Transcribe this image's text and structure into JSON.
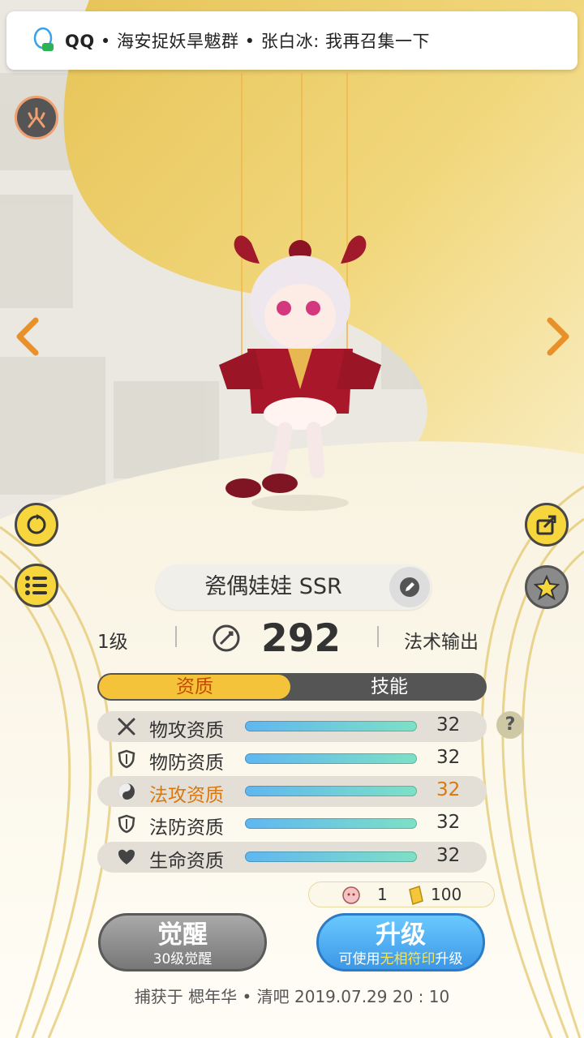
{
  "notification": {
    "app": "QQ",
    "text": "• 海安捉妖旱魃群 • 张白冰: 我再召集一下"
  },
  "pet": {
    "name": "瓷偶娃娃 SSR",
    "level": "1级",
    "power": "292",
    "role": "法术输出"
  },
  "tabs": {
    "active": "资质",
    "other": "技能"
  },
  "attributes": [
    {
      "icon": "crossed-swords-icon",
      "label": "物攻资质",
      "value": "32",
      "fill": 1.0
    },
    {
      "icon": "shield-icon",
      "label": "物防资质",
      "value": "32",
      "fill": 1.0
    },
    {
      "icon": "yin-yang-icon",
      "label": "法攻资质",
      "value": "32",
      "fill": 1.0
    },
    {
      "icon": "shield-icon",
      "label": "法防资质",
      "value": "32",
      "fill": 1.0
    },
    {
      "icon": "heart-icon",
      "label": "生命资质",
      "value": "32",
      "fill": 1.0
    }
  ],
  "help_label": "?",
  "cost": {
    "candy": "1",
    "coins": "100"
  },
  "buttons": {
    "awaken_main": "觉醒",
    "awaken_sub": "30级觉醒",
    "upgrade_main": "升级",
    "upgrade_sub_prefix": "可使用",
    "upgrade_sub_item": "无相符印",
    "upgrade_sub_suffix": "升级"
  },
  "captured": "捕获于 楒年华 • 清吧   2019.07.29   20 : 10",
  "colors": {
    "accent_yellow": "#f5c33a",
    "highlight_orange": "#d9780e",
    "upgrade_blue": "#3c97e6"
  }
}
